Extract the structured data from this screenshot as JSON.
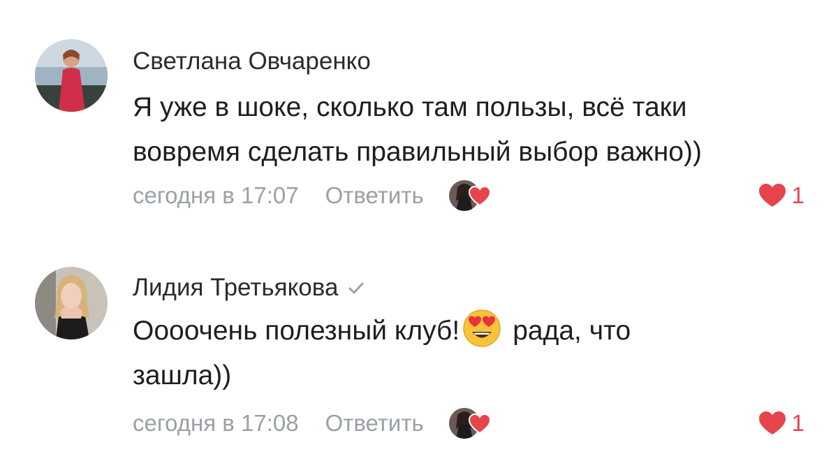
{
  "colors": {
    "heart": "#e6454e",
    "meta_text": "#9aa0a6",
    "verified": "#9aa0a6"
  },
  "comments": [
    {
      "author": "Светлана Овчаренко",
      "verified": false,
      "text_lines": [
        "Я уже в шоке, сколько там пользы, всё таки",
        "вовремя сделать правильный выбор важно))"
      ],
      "date": "сегодня в 17:07",
      "reply_label": "Ответить",
      "likes": "1",
      "liked_by_author_icon": "author-avatar-heart-icon"
    },
    {
      "author": "Лидия Третьякова",
      "verified": true,
      "text_before_emoji": "Оооочень полезный клуб!",
      "emoji": "heart-eyes-emoji",
      "text_after_emoji": "рада, что",
      "text_line2": "зашла))",
      "date": "сегодня в 17:08",
      "reply_label": "Ответить",
      "likes": "1",
      "liked_by_author_icon": "author-avatar-heart-icon"
    }
  ]
}
